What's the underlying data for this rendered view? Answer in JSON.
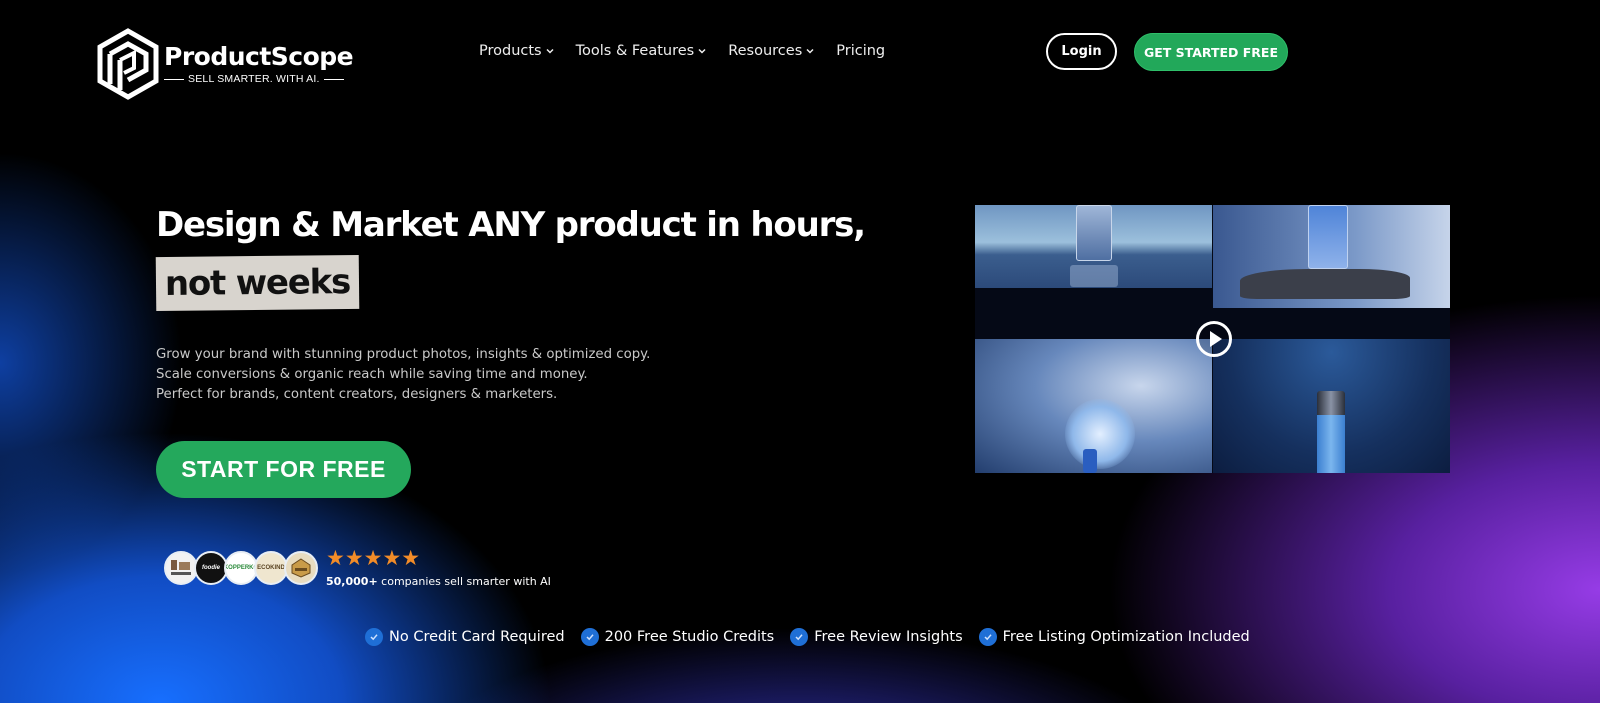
{
  "brand": {
    "name": "ProductScope",
    "tagline": "SELL SMARTER. WITH AI."
  },
  "nav": {
    "items": [
      {
        "label": "Products",
        "has_dropdown": true
      },
      {
        "label": "Tools & Features",
        "has_dropdown": true
      },
      {
        "label": "Resources",
        "has_dropdown": true
      },
      {
        "label": "Pricing",
        "has_dropdown": false
      }
    ],
    "login_label": "Login",
    "get_started_label": "GET STARTED FREE"
  },
  "hero": {
    "headline": "Design & Market ANY product in hours,",
    "highlight": "not weeks",
    "subtext": [
      "Grow your brand with stunning product photos, insights & optimized copy.",
      "Scale conversions & organic reach while saving time and money.",
      "Perfect for brands, content creators, designers & marketers."
    ],
    "cta_label": "START FOR FREE",
    "media_icon": "play-icon"
  },
  "social_proof": {
    "rating": 5,
    "rating_max": 5,
    "stars": "★★★★★",
    "count": "50,000+",
    "text": "companies sell smarter with AI",
    "customer_logos": [
      "logo-1",
      "foodie-goodie",
      "kopperkg",
      "ecokind",
      "logo-5"
    ]
  },
  "features": [
    "No Credit Card Required",
    "200 Free Studio Credits",
    "Free Review Insights",
    "Free Listing Optimization Included"
  ],
  "colors": {
    "primary_green": "#24a85c",
    "check_blue": "#1f6fd6",
    "star_orange": "#f28c28",
    "highlight_bg": "#d8d4ce"
  }
}
